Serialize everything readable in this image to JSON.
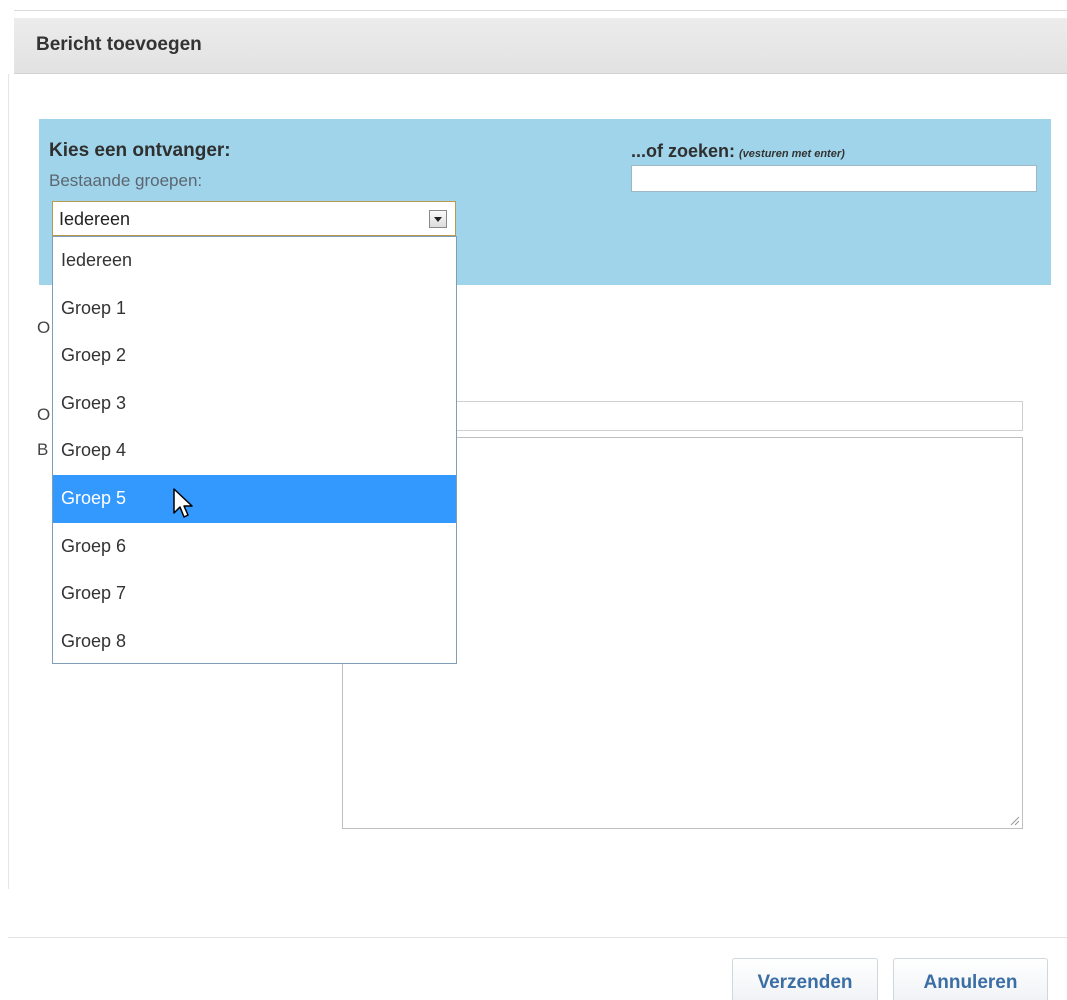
{
  "dialog": {
    "title": "Bericht toevoegen"
  },
  "recipient": {
    "choose_label": "Kies een ontvanger:",
    "groups_label": "Bestaande groepen:",
    "selected_group": "Iedereen",
    "search_label": "...of zoeken:",
    "search_hint": "(vesturen met enter)",
    "search_value": "",
    "options": [
      "Iedereen",
      "Groep 1",
      "Groep 2",
      "Groep 3",
      "Groep 4",
      "Groep 5",
      "Groep 6",
      "Groep 7",
      "Groep 8"
    ],
    "highlighted_option": "Groep 5"
  },
  "form": {
    "partial_label_1": "O",
    "partial_label_2": "O",
    "partial_label_3": "B",
    "subject_value": "",
    "message_value": ""
  },
  "footer": {
    "send_label": "Verzenden",
    "cancel_label": "Annuleren"
  },
  "colors": {
    "panel_bg": "#9fd4ea",
    "highlight": "#3399ff",
    "button_text": "#3a6ea5"
  },
  "icons": {
    "dropdown_arrow": "chevron-down-icon",
    "cursor": "mouse-pointer-icon",
    "resize": "resize-grip-icon"
  }
}
